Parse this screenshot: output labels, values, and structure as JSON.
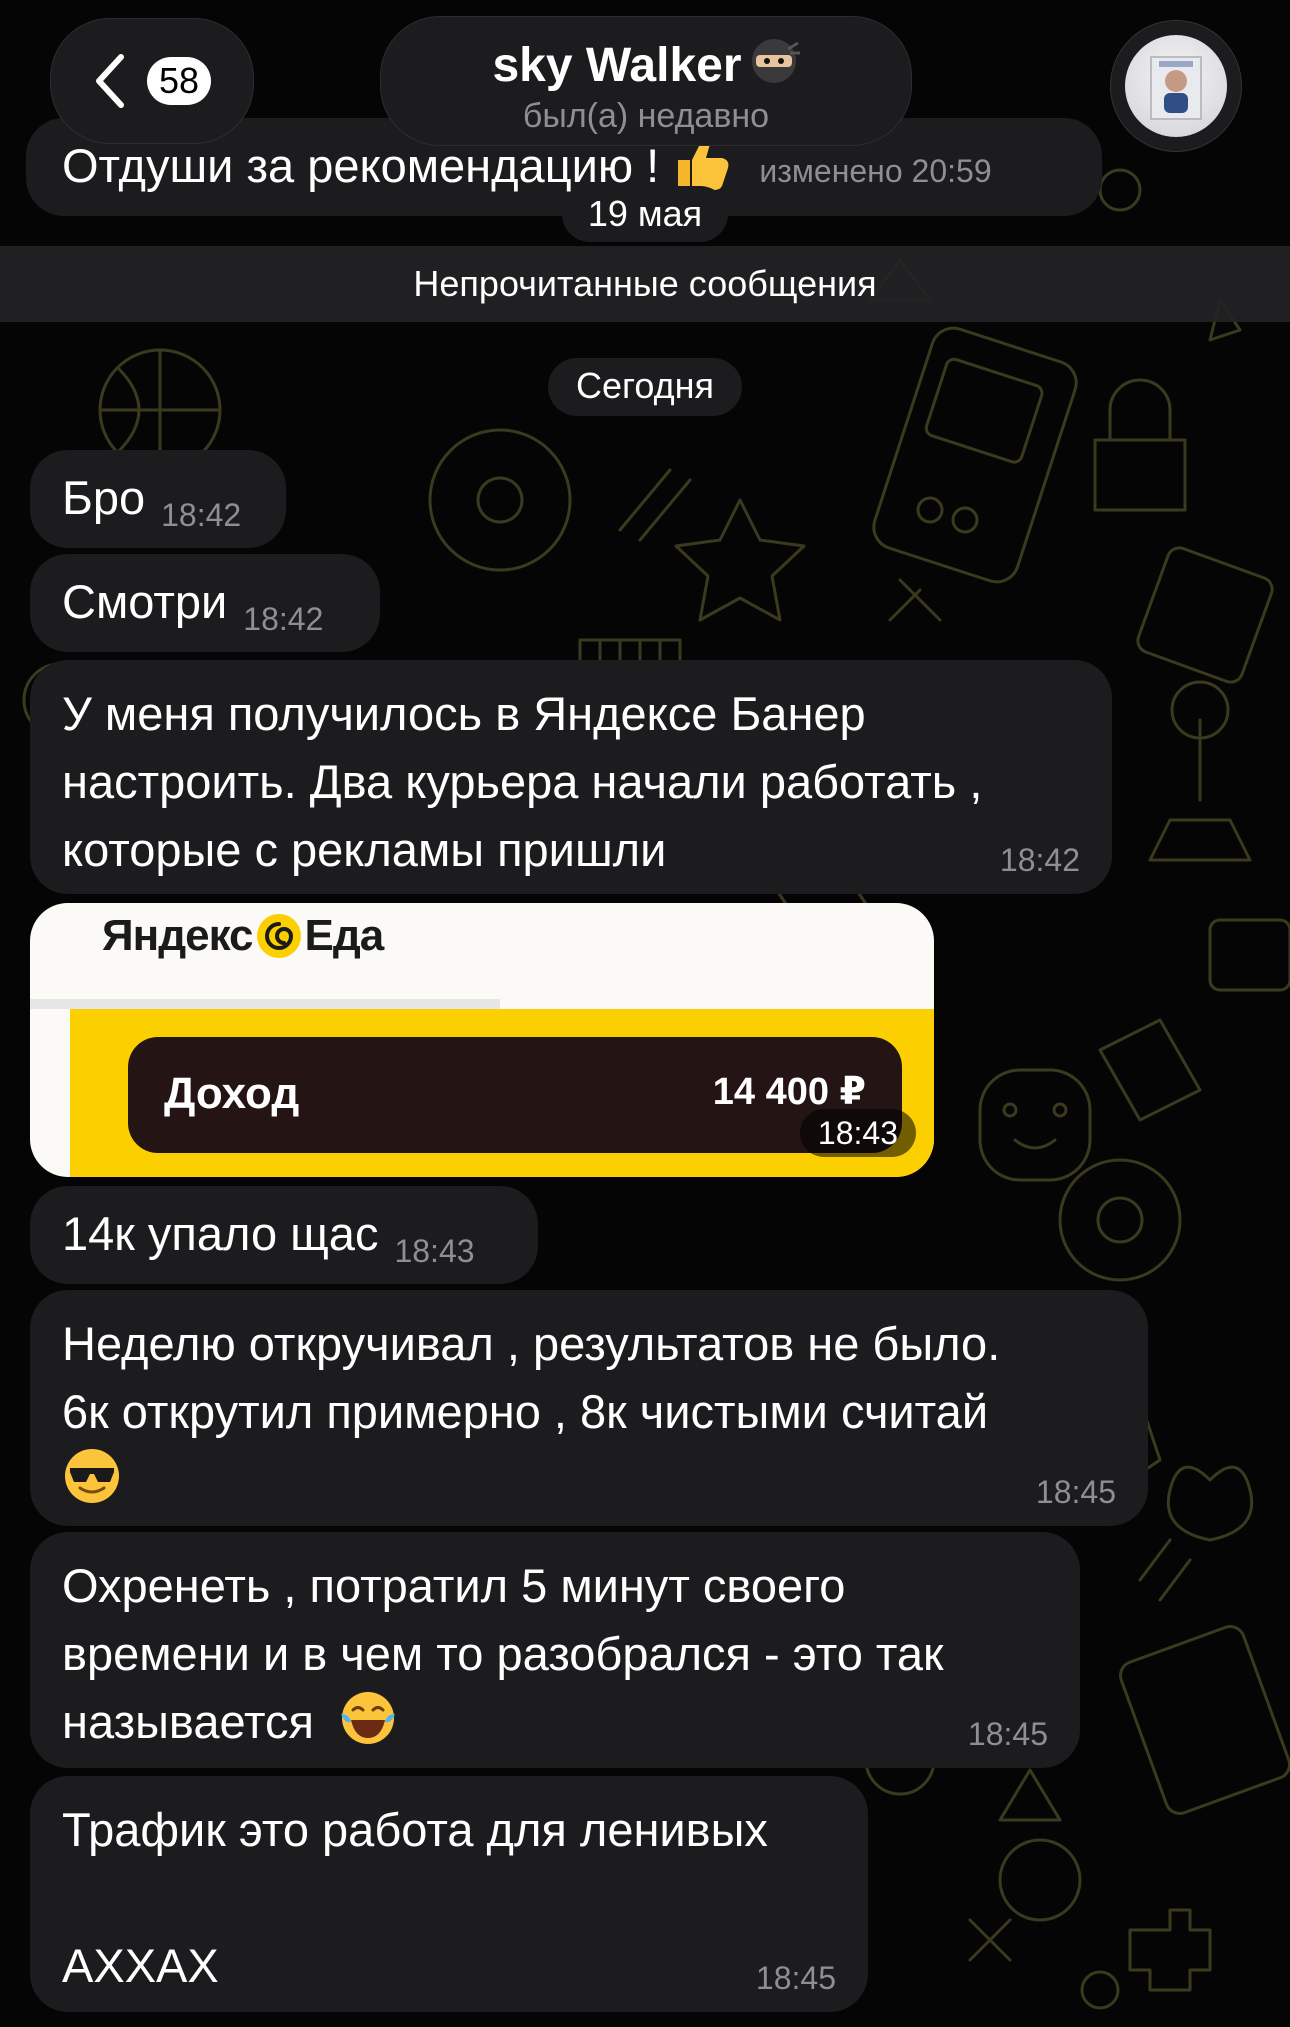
{
  "header": {
    "back_badge": "58",
    "contact_name": "sky Walker",
    "contact_status": "был(а) недавно"
  },
  "prev_message": {
    "text": "Отдуши за рекомендацию !",
    "edited": "изменено 20:59"
  },
  "dates": {
    "previous": "19 мая",
    "today": "Сегодня"
  },
  "unread_label": "Непрочитанные сообщения",
  "messages": [
    {
      "text": "Бро",
      "time": "18:42"
    },
    {
      "text": "Смотри",
      "time": "18:42"
    },
    {
      "lines": [
        "У меня получилось в Яндексе Банер",
        "настроить. Два курьера начали работать ,",
        "которые с рекламы пришли"
      ],
      "time": "18:42"
    },
    {
      "image": {
        "logo_left": "Яндекс",
        "logo_right": "Еда",
        "label": "Доход",
        "amount": "14 400 ₽"
      },
      "time": "18:43"
    },
    {
      "text": "14к упало щас",
      "time": "18:43"
    },
    {
      "lines": [
        "Неделю откручивал , результатов не было.",
        "6к открутил примерно , 8к чистыми считай"
      ],
      "time": "18:45"
    },
    {
      "lines": [
        "Охренеть , потратил 5 минут своего",
        "времени и в чем то разобрался - это так",
        "называется"
      ],
      "time": "18:45"
    },
    {
      "lines": [
        "Трафик это работа для ленивых",
        "АХХАХ"
      ],
      "time": "18:45"
    }
  ],
  "colors": {
    "background": "#050505",
    "bubble": "#1c1c1e",
    "timestamp": "#8e8e93",
    "yandex_yellow": "#fcd000",
    "doodle": "#3a3a1c"
  },
  "icons": [
    "chevron-left-icon",
    "ninja-emoji",
    "thumbs-up-emoji",
    "sunglasses-emoji",
    "tears-of-joy-emoji"
  ]
}
